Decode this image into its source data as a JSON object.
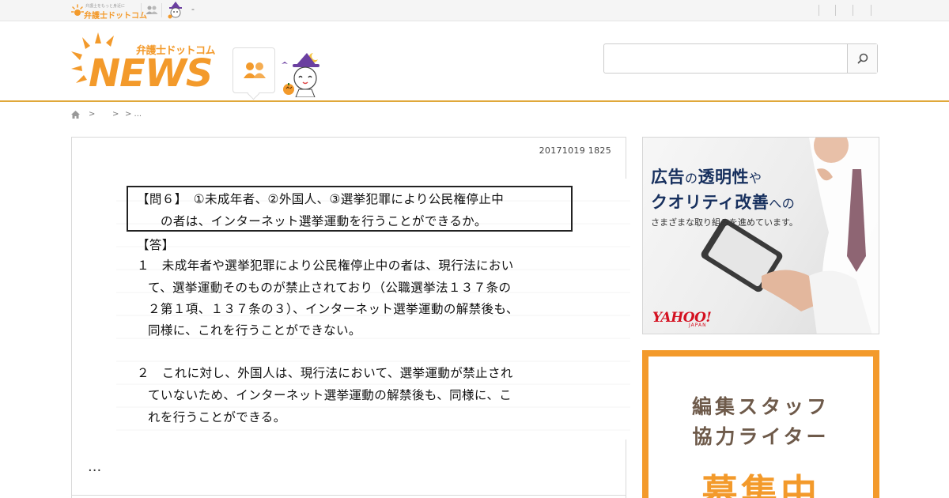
{
  "topbar": {
    "mini_logo_tagline": "弁護士をもっと身近に",
    "mini_logo_name": "弁護士ドットコム",
    "separator": "-"
  },
  "header": {
    "logo_sub": "弁護士ドットコム",
    "logo_main": "NEWS",
    "search": {
      "placeholder": "",
      "value": ""
    }
  },
  "breadcrumb": {
    "sep1": ">",
    "sep2": ">",
    "sep3": "> ..."
  },
  "article": {
    "date": "20171019 1825",
    "document_lines": [
      "【問６】　①未成年者、②外国人、③選挙犯罪により公民権停止中",
      "の者は、インターネット選挙運動を行うことができるか。",
      "【答】",
      "１　未成年者や選挙犯罪により公民権停止中の者は、現行法におい",
      "て、選挙運動そのものが禁止されており（公職選挙法１３７条の",
      "２第１項、１３７条の３）、インターネット選挙運動の解禁後も、",
      "同様に、これを行うことができない。",
      "２　これに対し、外国人は、現行法において、選挙運動が禁止され",
      "ていないため、インターネット選挙運動の解禁後も、同様に、こ",
      "れを行うことができる。"
    ],
    "ellipsis": "..."
  },
  "ad": {
    "line1_a": "広告",
    "line1_b": "の",
    "line1_c": "透明性",
    "line1_d": "や",
    "line2_a": "クオリティ改善",
    "line2_b": "への",
    "line3": "さまざまな取り組みを進めています。",
    "brand": "YAHOO!",
    "brand_sub": "JAPAN"
  },
  "recruit": {
    "line1": "編集スタッフ",
    "line2": "協力ライター",
    "line3": "募集中"
  },
  "colors": {
    "brand_orange": "#f39a2b",
    "header_rule": "#e0a83a",
    "ad_navy": "#17305e",
    "yahoo_red": "#d41020",
    "recruit_brown": "#6e5a4a"
  },
  "icons": [
    "sun-icon",
    "people-icon",
    "halloween-character-icon",
    "search-icon",
    "home-icon"
  ]
}
